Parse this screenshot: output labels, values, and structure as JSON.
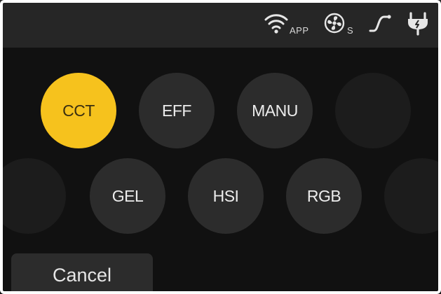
{
  "status_bar": {
    "icons": [
      {
        "name": "wifi-icon",
        "sublabel": "APP"
      },
      {
        "name": "fan-icon",
        "sublabel": "S"
      },
      {
        "name": "curve-icon",
        "sublabel": ""
      },
      {
        "name": "power-plug-icon",
        "sublabel": ""
      }
    ]
  },
  "modes": {
    "row1": [
      {
        "label": "CCT",
        "selected": true
      },
      {
        "label": "EFF",
        "selected": false
      },
      {
        "label": "MANU",
        "selected": false
      },
      {
        "label": "",
        "selected": false
      }
    ],
    "row2": [
      {
        "label": "",
        "selected": false
      },
      {
        "label": "GEL",
        "selected": false
      },
      {
        "label": "HSI",
        "selected": false
      },
      {
        "label": "RGB",
        "selected": false
      },
      {
        "label": "",
        "selected": false
      }
    ]
  },
  "cancel_label": "Cancel",
  "colors": {
    "accent": "#f6c21d",
    "button_bg": "#2c2c2c",
    "screen_bg": "#111111",
    "topbar_bg": "#262626"
  }
}
